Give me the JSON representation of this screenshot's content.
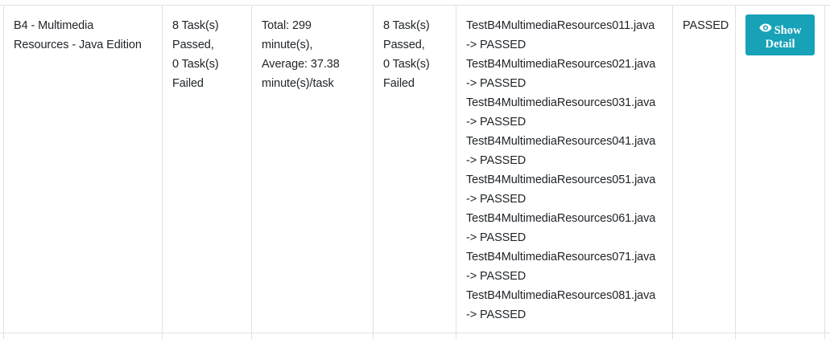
{
  "row": {
    "name": [
      "B4 - Multimedia",
      "Resources - Java Edition"
    ],
    "tasks_summary": [
      "8 Task(s)",
      "Passed,",
      "0 Task(s)",
      "Failed"
    ],
    "time": [
      "Total: 299",
      "minute(s),",
      "Average: 37.38",
      "minute(s)/task"
    ],
    "tasks_summary_2": [
      "8 Task(s)",
      "Passed,",
      "0 Task(s)",
      "Failed"
    ],
    "results": [
      "TestB4MultimediaResources011.java",
      "-> PASSED",
      "TestB4MultimediaResources021.java",
      "-> PASSED",
      "TestB4MultimediaResources031.java",
      "-> PASSED",
      "TestB4MultimediaResources041.java",
      "-> PASSED",
      "TestB4MultimediaResources051.java",
      "-> PASSED",
      "TestB4MultimediaResources061.java",
      "-> PASSED",
      "TestB4MultimediaResources071.java",
      "-> PASSED",
      "TestB4MultimediaResources081.java",
      "-> PASSED"
    ],
    "status": "PASSED",
    "button": {
      "line1": "Show",
      "line2": "Detail",
      "icon": "eye-icon",
      "color": "#17a2b8"
    }
  }
}
